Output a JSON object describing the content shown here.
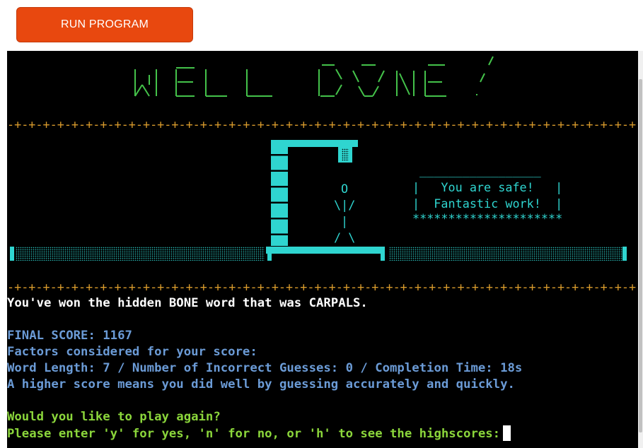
{
  "toolbar": {
    "run_label": "RUN PROGRAM"
  },
  "banner": {
    "text": "WELL DONE!"
  },
  "divider": "-+-+-+-+-+-+-+-+-+-+-+-+-+-+-+-+-+-+-+-+-+-+-+-+-+-+-+-+-+-+-+-+-+-+-+-+-+-+-+-+-+-+-+-+",
  "hangman": {
    "head": "O",
    "arms": "\\|/",
    "body": "|",
    "legs": "/ \\"
  },
  "sign": {
    "top": "_________________",
    "line1": "|   You are safe!   |",
    "line2": "|  Fantastic work!  |",
    "bottom": "*********************"
  },
  "result": {
    "won_text": "You've won the hidden BONE word that was CARPALS."
  },
  "score": {
    "final": "FINAL SCORE: 1167",
    "factors_heading": "Factors considered for your score:",
    "factors": "Word Length: 7 / Number of Incorrect Guesses: 0 / Completion Time: 18s",
    "explanation": "A higher score means you did well by guessing accurately and quickly."
  },
  "prompt": {
    "question": "Would you like to play again?",
    "instruction": "Please enter 'y' for yes, 'n' for no, or 'h' to see the highscores:"
  },
  "colors": {
    "button": "#e8480f",
    "banner": "#44c24a",
    "divider": "#d89a2c",
    "gallows": "#2fd5d0",
    "white_text": "#ffffff",
    "blue_text": "#6b9bd6",
    "green_text": "#8bd63b"
  }
}
